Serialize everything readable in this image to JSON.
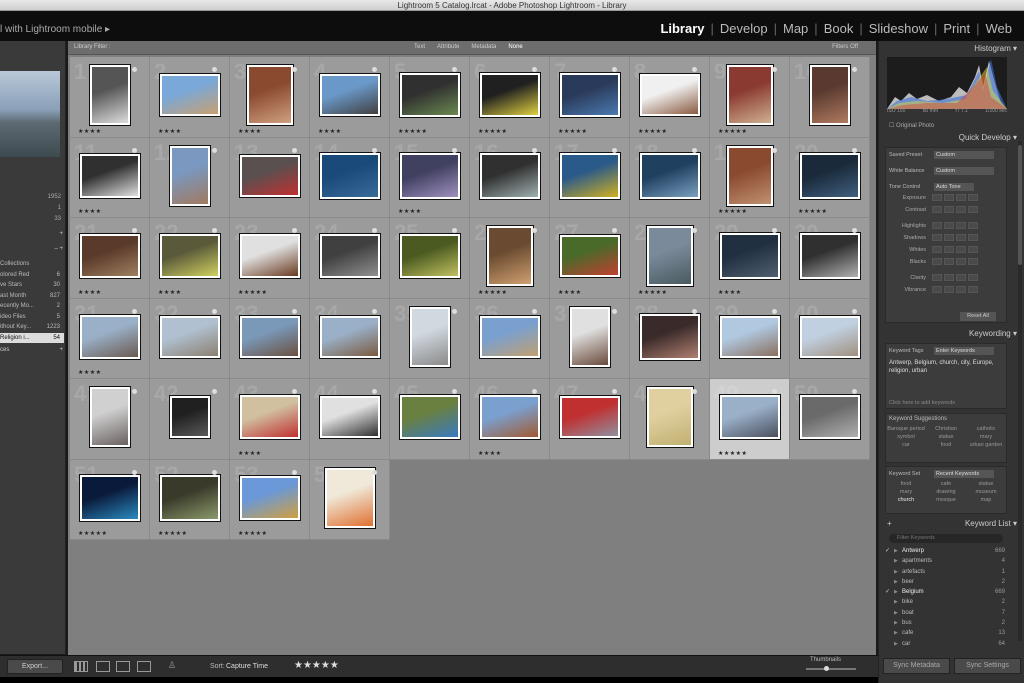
{
  "window": {
    "title": "Lightroom 5 Catalog.lrcat - Adobe Photoshop Lightroom - Library"
  },
  "identity_plate": "l with Lightroom mobile  ▸",
  "modules": [
    {
      "label": "Library",
      "active": true
    },
    {
      "label": "Develop"
    },
    {
      "label": "Map"
    },
    {
      "label": "Book"
    },
    {
      "label": "Slideshow"
    },
    {
      "label": "Print"
    },
    {
      "label": "Web"
    }
  ],
  "left": {
    "catalog_counts": [
      "1952",
      "1",
      "33"
    ],
    "collections_header_sign": "–  +",
    "collections": [
      {
        "label": "Collections",
        "count": ""
      },
      {
        "label": "olored Red",
        "count": "6"
      },
      {
        "label": "ve Stars",
        "count": "30"
      },
      {
        "label": "ast Month",
        "count": "827"
      },
      {
        "label": "ecently Mo...",
        "count": "2"
      },
      {
        "label": "ideo Files",
        "count": "5"
      },
      {
        "label": "ithout Key...",
        "count": "1223"
      },
      {
        "label": "Religion i...",
        "count": "54",
        "selected": true
      }
    ],
    "publish_label": "ces",
    "export_button": "Export..."
  },
  "filterbar": {
    "label": "Library Filter :",
    "options": [
      "Text",
      "Attribute",
      "Metadata",
      "None"
    ],
    "active_option": "None",
    "filters_off": "Filters Off"
  },
  "grid": {
    "cells": [
      {
        "n": "1",
        "stars": "★★★★",
        "w": 40,
        "h": 60,
        "c1": "#555",
        "c2": "#ddd"
      },
      {
        "n": "2",
        "stars": "★★★★",
        "w": 60,
        "h": 42,
        "c1": "#7aa8d8",
        "c2": "#c8a070"
      },
      {
        "n": "3",
        "stars": "★★★★",
        "w": 46,
        "h": 60,
        "c1": "#8a4a30",
        "c2": "#d0a080"
      },
      {
        "n": "4",
        "stars": "★★★★",
        "w": 60,
        "h": 42,
        "c1": "#6a98c8",
        "c2": "#404040"
      },
      {
        "n": "5",
        "stars": "★★★★★",
        "w": 60,
        "h": 44,
        "c1": "#303030",
        "c2": "#6a8a50"
      },
      {
        "n": "6",
        "stars": "★★★★★",
        "w": 60,
        "h": 44,
        "c1": "#202020",
        "c2": "#e0d040"
      },
      {
        "n": "7",
        "stars": "★★★★★",
        "w": 60,
        "h": 44,
        "c1": "#2a3a5a",
        "c2": "#4a7ab0"
      },
      {
        "n": "8",
        "stars": "★★★★★",
        "w": 60,
        "h": 42,
        "c1": "#f0f0f0",
        "c2": "#8a5a40"
      },
      {
        "n": "9",
        "stars": "★★★★★",
        "w": 46,
        "h": 60,
        "c1": "#8a3a30",
        "c2": "#d0b090"
      },
      {
        "n": "10",
        "stars": "",
        "w": 40,
        "h": 60,
        "c1": "#5a3a30",
        "c2": "#b07a60"
      },
      {
        "n": "11",
        "stars": "★★★★",
        "w": 60,
        "h": 44,
        "c1": "#303030",
        "c2": "#e0e0e0"
      },
      {
        "n": "12",
        "stars": "",
        "w": 40,
        "h": 60,
        "c1": "#7a98c0",
        "c2": "#a07a60"
      },
      {
        "n": "13",
        "stars": "",
        "w": 60,
        "h": 42,
        "c1": "#5a5050",
        "c2": "#c03030"
      },
      {
        "n": "14",
        "stars": "",
        "w": 60,
        "h": 46,
        "c1": "#1a4a7a",
        "c2": "#3a6a9a"
      },
      {
        "n": "15",
        "stars": "★★★★",
        "w": 60,
        "h": 46,
        "c1": "#404060",
        "c2": "#a090c0"
      },
      {
        "n": "16",
        "stars": "",
        "w": 60,
        "h": 46,
        "c1": "#303030",
        "c2": "#a0b0b0"
      },
      {
        "n": "17",
        "stars": "",
        "w": 60,
        "h": 46,
        "c1": "#2a5a8a",
        "c2": "#d0b020"
      },
      {
        "n": "18",
        "stars": "",
        "w": 60,
        "h": 46,
        "c1": "#204060",
        "c2": "#7aa0c0"
      },
      {
        "n": "19",
        "stars": "★★★★★",
        "w": 46,
        "h": 60,
        "c1": "#8a4a30",
        "c2": "#c09070"
      },
      {
        "n": "20",
        "stars": "★★★★★",
        "w": 60,
        "h": 46,
        "c1": "#1a2a3a",
        "c2": "#406080"
      },
      {
        "n": "21",
        "stars": "★★★★",
        "w": 60,
        "h": 44,
        "c1": "#5a3a2a",
        "c2": "#a08060"
      },
      {
        "n": "22",
        "stars": "★★★★",
        "w": 60,
        "h": 44,
        "c1": "#5a5a3a",
        "c2": "#d0d060"
      },
      {
        "n": "23",
        "stars": "★★★★★",
        "w": 60,
        "h": 44,
        "c1": "#e0e0e0",
        "c2": "#6a3a20"
      },
      {
        "n": "24",
        "stars": "",
        "w": 60,
        "h": 44,
        "c1": "#404040",
        "c2": "#909090"
      },
      {
        "n": "25",
        "stars": "",
        "w": 60,
        "h": 44,
        "c1": "#4a5a20",
        "c2": "#c0c060"
      },
      {
        "n": "26",
        "stars": "★★★★★",
        "w": 46,
        "h": 60,
        "c1": "#6a4a30",
        "c2": "#d0a070"
      },
      {
        "n": "27",
        "stars": "★★★★",
        "w": 60,
        "h": 42,
        "c1": "#4a6a2a",
        "c2": "#c04030"
      },
      {
        "n": "28",
        "stars": "★★★★★",
        "w": 46,
        "h": 60,
        "c1": "#7a8a9a",
        "c2": "#4a5a60"
      },
      {
        "n": "29",
        "stars": "★★★★",
        "w": 60,
        "h": 46,
        "c1": "#203040",
        "c2": "#506070"
      },
      {
        "n": "30",
        "stars": "",
        "w": 60,
        "h": 46,
        "c1": "#303030",
        "c2": "#b0b0b0"
      },
      {
        "n": "31",
        "stars": "★★★★",
        "w": 60,
        "h": 44,
        "c1": "#9ab0c8",
        "c2": "#6a5a50"
      },
      {
        "n": "32",
        "stars": "",
        "w": 60,
        "h": 42,
        "c1": "#b0c0d0",
        "c2": "#8a8070"
      },
      {
        "n": "33",
        "stars": "",
        "w": 60,
        "h": 42,
        "c1": "#7a98b8",
        "c2": "#6a5040"
      },
      {
        "n": "34",
        "stars": "",
        "w": 60,
        "h": 42,
        "c1": "#9ab0c8",
        "c2": "#7a5a40"
      },
      {
        "n": "35",
        "stars": "",
        "w": 40,
        "h": 60,
        "c1": "#d0d8e0",
        "c2": "#8a8a8a"
      },
      {
        "n": "36",
        "stars": "",
        "w": 60,
        "h": 42,
        "c1": "#7aa0d0",
        "c2": "#c0a070"
      },
      {
        "n": "37",
        "stars": "",
        "w": 40,
        "h": 60,
        "c1": "#e0e0e0",
        "c2": "#6a4a3a"
      },
      {
        "n": "38",
        "stars": "",
        "w": 60,
        "h": 46,
        "c1": "#3a2a2a",
        "c2": "#b08070"
      },
      {
        "n": "39",
        "stars": "",
        "w": 60,
        "h": 42,
        "c1": "#b0c8e0",
        "c2": "#8a7060"
      },
      {
        "n": "40",
        "stars": "",
        "w": 60,
        "h": 42,
        "c1": "#c0d0e0",
        "c2": "#a09080"
      },
      {
        "n": "41",
        "stars": "",
        "w": 40,
        "h": 60,
        "c1": "#d0d0d0",
        "c2": "#6a6060"
      },
      {
        "n": "42",
        "stars": "",
        "w": 40,
        "h": 42,
        "c1": "#202020",
        "c2": "#5a5a5a"
      },
      {
        "n": "43",
        "stars": "★★★★",
        "w": 60,
        "h": 44,
        "c1": "#d0c0a0",
        "c2": "#c03030"
      },
      {
        "n": "44",
        "stars": "",
        "w": 60,
        "h": 42,
        "c1": "#e0e0e0",
        "c2": "#303030"
      },
      {
        "n": "45",
        "stars": "",
        "w": 60,
        "h": 44,
        "c1": "#6a8040",
        "c2": "#3a7ac0"
      },
      {
        "n": "46",
        "stars": "★★★★",
        "w": 60,
        "h": 44,
        "c1": "#7aa0d0",
        "c2": "#a05a30"
      },
      {
        "n": "47",
        "stars": "",
        "w": 60,
        "h": 42,
        "c1": "#c03030",
        "c2": "#9090a0"
      },
      {
        "n": "48",
        "stars": "",
        "w": 46,
        "h": 60,
        "c1": "#e0d0a0",
        "c2": "#c0b070"
      },
      {
        "n": "49",
        "stars": "★★★★★",
        "w": 60,
        "h": 44,
        "c1": "#9ab0c8",
        "c2": "#4a5060",
        "selected": true
      },
      {
        "n": "50",
        "stars": "",
        "w": 60,
        "h": 44,
        "c1": "#6a6a6a",
        "c2": "#b0b0b0"
      },
      {
        "n": "51",
        "stars": "★★★★★",
        "w": 60,
        "h": 46,
        "c1": "#0a1a3a",
        "c2": "#2a8ac0"
      },
      {
        "n": "52",
        "stars": "★★★★★",
        "w": 60,
        "h": 46,
        "c1": "#3a3a2a",
        "c2": "#8a9a6a"
      },
      {
        "n": "53",
        "stars": "★★★★★",
        "w": 60,
        "h": 44,
        "c1": "#6a98d8",
        "c2": "#d0a040"
      },
      {
        "n": "54",
        "stars": "",
        "w": 50,
        "h": 60,
        "c1": "#f0e8d8",
        "c2": "#e07030"
      }
    ]
  },
  "toolbar": {
    "sort_label": "Sort:",
    "sort_value": "Capture Time",
    "stars": "★★★★★",
    "thumbnails_label": "Thumbnails"
  },
  "right": {
    "histogram_title": "Histogram",
    "hist_info": [
      "ISO 100",
      "80 mm",
      "f / 7.1",
      "1/200 sec"
    ],
    "original_photo": "Original Photo",
    "quick_develop_title": "Quick Develop",
    "saved_preset_label": "Saved Preset",
    "saved_preset_value": "Custom",
    "white_balance_label": "White Balance",
    "white_balance_value": "Custom",
    "tone_control_label": "Tone Control",
    "auto_tone": "Auto Tone",
    "tone_rows": [
      "Exposure",
      "Contrast",
      "Highlights",
      "Shadows",
      "Whites",
      "Blacks",
      "Clarity",
      "Vibrance"
    ],
    "reset_all": "Reset All",
    "keywording_title": "Keywording",
    "keyword_tags_label": "Keyword Tags",
    "keyword_tags_value": "Enter Keywords",
    "keywords_text": "Antwerp, Belgium, church, city, Europe, religion, urban",
    "add_keywords_placeholder": "Click here to add keywords",
    "suggestions_label": "Keyword Suggestions",
    "suggestions": [
      "Baroque period",
      "Christian",
      "catholic",
      "symbol",
      "statue",
      "mary",
      "car",
      "food",
      "urban garden"
    ],
    "keyword_set_label": "Keyword Set",
    "keyword_set_value": "Recent Keywords",
    "keyword_set": [
      "food",
      "cafe",
      "statue",
      "mary",
      "drawing",
      "museum",
      "church",
      "mosque",
      "map"
    ],
    "keyword_set_active": "church",
    "keyword_list_title": "Keyword List",
    "keyword_filter_placeholder": "Filter Keywords",
    "keyword_list": [
      {
        "name": "Antwerp",
        "count": "669",
        "checked": true
      },
      {
        "name": "apartments",
        "count": "4"
      },
      {
        "name": "artefacts",
        "count": "1"
      },
      {
        "name": "beer",
        "count": "2"
      },
      {
        "name": "Belgium",
        "count": "669",
        "checked": true
      },
      {
        "name": "bike",
        "count": "2"
      },
      {
        "name": "boat",
        "count": "7"
      },
      {
        "name": "bus",
        "count": "2"
      },
      {
        "name": "cafe",
        "count": "13"
      },
      {
        "name": "car",
        "count": "64"
      }
    ],
    "sync_metadata": "Sync Metadata",
    "sync_settings": "Sync Settings"
  }
}
